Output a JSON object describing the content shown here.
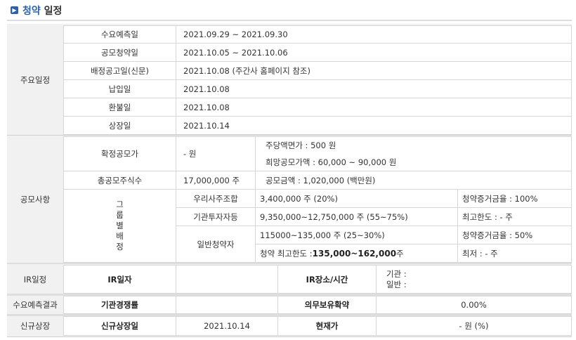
{
  "header": {
    "icon": "arrow-right-icon",
    "title_accent": "청약",
    "title_rest": " 일정"
  },
  "schedule": {
    "section_label": "주요일정",
    "rows": [
      {
        "label": "수요예측일",
        "value": "2021.09.29  ~  2021.09.30"
      },
      {
        "label": "공모청약일",
        "value": "2021.10.05  ~  2021.10.06"
      },
      {
        "label": "배정공고일(신문)",
        "value": "2021.10.08 (주간사 홈페이지 참조)"
      },
      {
        "label": "납입일",
        "value": "2021.10.08"
      },
      {
        "label": "환불일",
        "value": "2021.10.08"
      },
      {
        "label": "상장일",
        "value": "2021.10.14"
      }
    ]
  },
  "offering": {
    "section_label": "공모사항",
    "fixed_price_label": "확정공모가",
    "fixed_price_value": "- 원",
    "par_value": "주당액면가 :  500 원",
    "hope_price": "희망공모가액 :  60,000 ~ 90,000 원",
    "total_shares_label": "총공모주식수",
    "total_shares_value": "17,000,000 주",
    "offering_amount": "공모금액 : 1,020,000 (백만원)",
    "group_label_chars": [
      "그",
      "룹",
      "별",
      "배",
      "정"
    ],
    "groups": [
      {
        "name": "우리사주조합",
        "shares": "3,400,000 주  (20%)",
        "note": "청약증거금율 : 100%"
      },
      {
        "name": "기관투자자등",
        "shares": "9,350,000~12,750,000 주  (55~75%)",
        "note": "최고한도 :  - 주"
      },
      {
        "name": "일반청약자",
        "shares": "115000~135,000 주  (25~30%)",
        "note": "청약증거금율 : 50%"
      }
    ],
    "retail_limit_label": "청약 최고한도 : ",
    "retail_limit_value": "135,000~162,000",
    "retail_limit_unit": " 주",
    "retail_min": "최저 :  - 주"
  },
  "ir": {
    "section_label": "IR일정",
    "date_label": "IR일자",
    "date_value": "",
    "place_label": "IR장소/시간",
    "inst_label": "기관 :",
    "retail_label": "일반 :"
  },
  "demand_result": {
    "section_label": "수요예측결과",
    "competition_label": "기관경쟁률",
    "competition_value": "",
    "lockup_label": "의무보유확약",
    "lockup_value": "0.00%"
  },
  "listing": {
    "section_label": "신규상장",
    "date_label": "신규상장일",
    "date_value": "2021.10.14",
    "price_label": "현재가",
    "price_value": "- 원 (%)"
  }
}
